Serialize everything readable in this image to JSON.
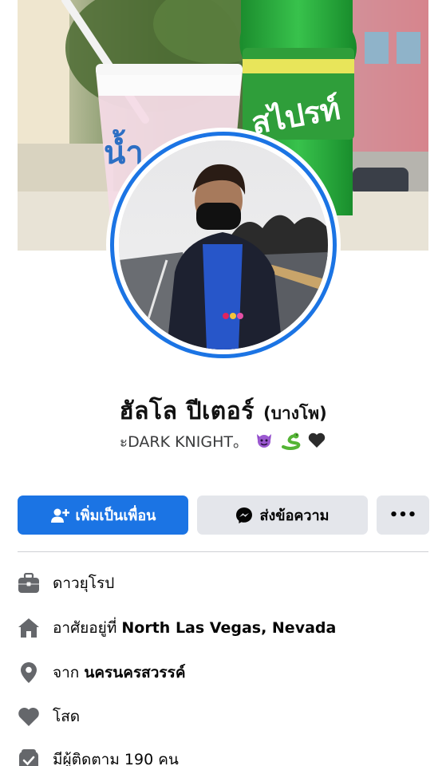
{
  "profile": {
    "name": "ฮัลโล ปีเตอร์",
    "alternate_name": "(บางโพ)",
    "bio_text": "ะDARK KNIGHT。",
    "bio_emojis": [
      "devil-emoji",
      "snake-emoji",
      "black-heart-emoji"
    ]
  },
  "cover": {
    "bottle_label": "สไปรท์",
    "cup_label": "น้ำ"
  },
  "actions": {
    "add_friend_label": "เพิ่มเป็นเพื่อน",
    "message_label": "ส่งข้อความ",
    "more_label": "•••"
  },
  "info": {
    "work": "ดาวยุโรป",
    "lives_in_prefix": "อาศัยอยู่ที่",
    "lives_in_value": "North Las Vegas, Nevada",
    "from_prefix": "จาก",
    "from_value": "นครนครสวรรค์",
    "relationship": "โสด",
    "followers": "มีผู้ติดตาม 190 คน"
  },
  "colors": {
    "accent": "#1b74e4",
    "secondary_button": "#e4e6eb",
    "icon_gray": "#65676b"
  },
  "icons": {
    "add_friend": "person-plus-icon",
    "message": "messenger-icon",
    "work": "briefcase-icon",
    "home": "home-icon",
    "from": "location-pin-icon",
    "relationship": "heart-icon",
    "followers": "followers-icon"
  }
}
